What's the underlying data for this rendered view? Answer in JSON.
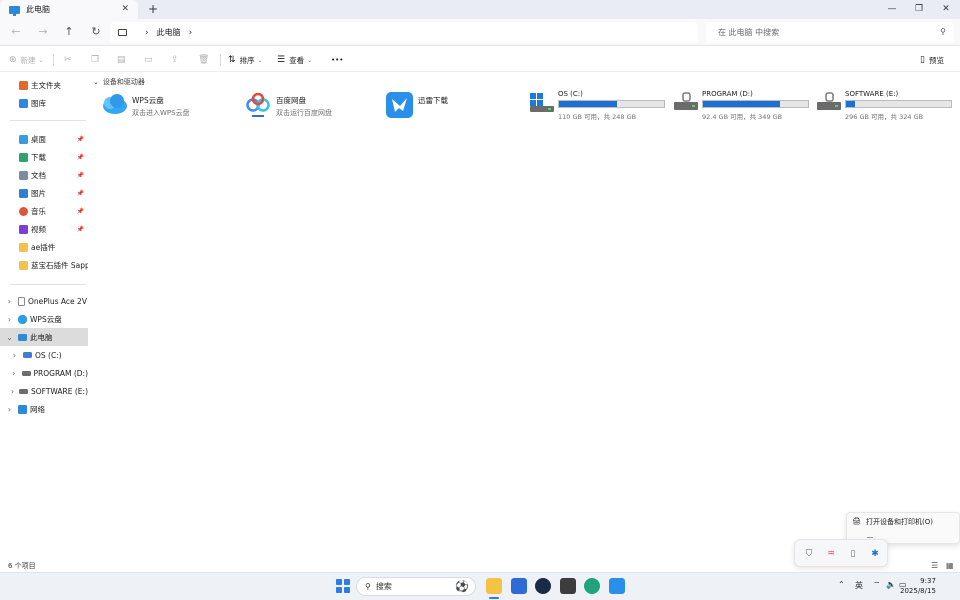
{
  "window": {
    "tab_label": "此电脑",
    "tab_close": "✕",
    "new_tab": "+",
    "minimize": "—",
    "restore": "❐",
    "close": "✕"
  },
  "nav": {
    "back": "←",
    "forward": "→",
    "up": "↑",
    "refresh": "↻",
    "breadcrumb": [
      "此电脑"
    ],
    "breadcrumb_sep": "›",
    "search_placeholder": "在 此电脑 中搜索"
  },
  "toolbar": {
    "new_label": "新建",
    "sort_label": "排序",
    "view_label": "查看",
    "more_label": "•••",
    "preview_label": "预览"
  },
  "sidebar": {
    "quick": [
      {
        "label": "主文件夹",
        "icon": "home-icon",
        "color": "#e06a2c",
        "pinned": false
      },
      {
        "label": "图库",
        "icon": "gallery-icon",
        "color": "#2e86de",
        "pinned": false
      }
    ],
    "pinned": [
      {
        "label": "桌面",
        "icon": "desktop-icon",
        "color": "#3a9be0"
      },
      {
        "label": "下载",
        "icon": "download-icon",
        "color": "#2fa36b"
      },
      {
        "label": "文档",
        "icon": "documents-icon",
        "color": "#7c8ba1"
      },
      {
        "label": "图片",
        "icon": "pictures-icon",
        "color": "#2f7fd6"
      },
      {
        "label": "音乐",
        "icon": "music-icon",
        "color": "#e0543a"
      },
      {
        "label": "视频",
        "icon": "video-icon",
        "color": "#7b3fd1"
      }
    ],
    "folders": [
      {
        "label": "ae插件",
        "icon": "folder-icon",
        "color": "#f2c14e"
      },
      {
        "label": "蓝宝石插件 Sapphi",
        "icon": "folder-icon",
        "color": "#f2c14e"
      }
    ],
    "tree": [
      {
        "label": "OnePlus Ace 2V",
        "icon": "phone-icon",
        "color": "#8a8a8a",
        "indent": 0,
        "chevron": "›",
        "selected": false
      },
      {
        "label": "WPS云盘",
        "icon": "cloud-icon",
        "color": "#2e9bea",
        "indent": 0,
        "chevron": "›",
        "selected": false
      },
      {
        "label": "此电脑",
        "icon": "pc-icon",
        "color": "#2d8ad8",
        "indent": 0,
        "chevron": "⌄",
        "selected": true
      },
      {
        "label": "OS (C:)",
        "icon": "drive-icon",
        "color": "#3f7fcf",
        "indent": 1,
        "chevron": "›",
        "selected": false
      },
      {
        "label": "PROGRAM (D:)",
        "icon": "drive-icon",
        "color": "#6d6d6d",
        "indent": 1,
        "chevron": "›",
        "selected": false
      },
      {
        "label": "SOFTWARE (E:)",
        "icon": "drive-icon",
        "color": "#6d6d6d",
        "indent": 1,
        "chevron": "›",
        "selected": false
      },
      {
        "label": "网络",
        "icon": "network-icon",
        "color": "#2d8ad8",
        "indent": 0,
        "chevron": "›",
        "selected": false
      }
    ]
  },
  "content": {
    "group_header": "设备和驱动器",
    "locations": [
      {
        "name": "WPS云盘",
        "sub": "双击进入WPS云盘",
        "icon": "wps-cloud-icon"
      },
      {
        "name": "百度网盘",
        "sub": "双击运行百度网盘",
        "icon": "baidu-netdisk-icon"
      },
      {
        "name": "迅雷下载",
        "sub": "",
        "icon": "xunlei-icon"
      }
    ],
    "drives": [
      {
        "name": "OS (C:)",
        "free_text": "110 GB 可用，共 248 GB",
        "used_fraction": 0.556,
        "icon": "windows-drive-icon"
      },
      {
        "name": "PROGRAM (D:)",
        "free_text": "92.4 GB 可用，共 349 GB",
        "used_fraction": 0.735,
        "icon": "drive-icon"
      },
      {
        "name": "SOFTWARE (E:)",
        "free_text": "296 GB 可用，共 324 GB",
        "used_fraction": 0.086,
        "icon": "drive-icon"
      }
    ]
  },
  "status": {
    "item_count": "6 个项目"
  },
  "popup": {
    "printer_label": "打开设备和打印机(O)"
  },
  "taskbar": {
    "search_label": "搜索",
    "ime": "英",
    "time": "9:37",
    "date": "2025/8/15"
  }
}
